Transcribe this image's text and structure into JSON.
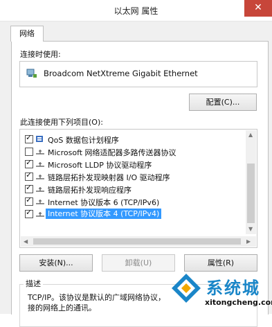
{
  "window": {
    "title": "以太网 属性",
    "close_glyph": "✕"
  },
  "tabs": [
    {
      "label": "网络",
      "active": true
    }
  ],
  "connect_using": {
    "label": "连接时使用:",
    "adapter": "Broadcom NetXtreme Gigabit Ethernet",
    "configure_button": "配置(C)..."
  },
  "items_section": {
    "label": "此连接使用下列项目(O):",
    "items": [
      {
        "label": "QoS 数据包计划程序",
        "checked": true,
        "icon": "qos-scheduler-icon"
      },
      {
        "label": "Microsoft 网络适配器多路传送器协议",
        "checked": false,
        "icon": "protocol-icon"
      },
      {
        "label": "Microsoft LLDP 协议驱动程序",
        "checked": true,
        "icon": "protocol-icon"
      },
      {
        "label": "链路层拓扑发现映射器 I/O 驱动程序",
        "checked": true,
        "icon": "protocol-icon"
      },
      {
        "label": "链路层拓扑发现响应程序",
        "checked": true,
        "icon": "protocol-icon"
      },
      {
        "label": "Internet 协议版本 6 (TCP/IPv6)",
        "checked": true,
        "icon": "protocol-icon"
      },
      {
        "label": "Internet 协议版本 4 (TCP/IPv4)",
        "checked": true,
        "icon": "protocol-icon",
        "selected": true
      }
    ]
  },
  "buttons": {
    "install": "安装(N)...",
    "uninstall": "卸载(U)",
    "properties": "属性(R)"
  },
  "description": {
    "title": "描述",
    "text": "TCP/IP。该协议是默认的广域网络协议，",
    "text_line2": "接的网络上的通讯。"
  },
  "watermark": {
    "cn": "系统城",
    "en": "xitongcheng.com",
    "accent_color": "#1a86c8"
  }
}
